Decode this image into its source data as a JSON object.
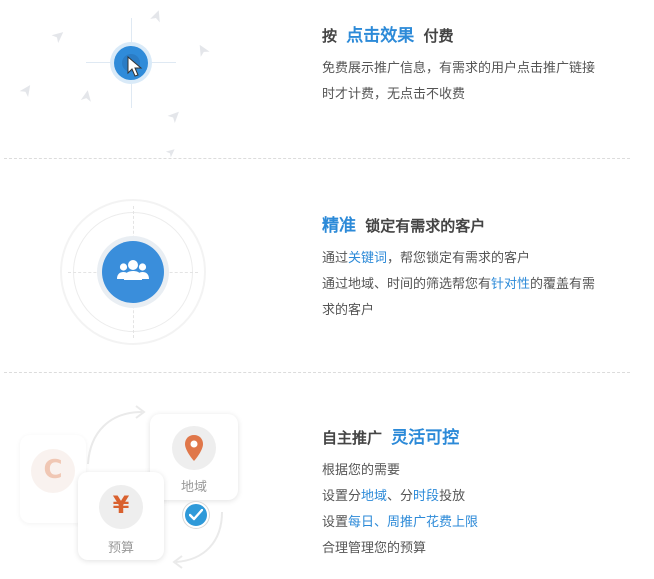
{
  "sections": [
    {
      "title_prefix": "按",
      "title_highlight": "点击效果",
      "title_suffix": "付费",
      "desc": [
        "免费展示推广信息，有需求的用户点击推广链接",
        "时才计费，无点击不收费"
      ]
    },
    {
      "title_highlight": "精准",
      "title_suffix": "锁定有需求的客户",
      "line1": {
        "pre": "通过",
        "kw": "关键词",
        "post": "，帮您锁定有需求的客户"
      },
      "line2": {
        "pre": "通过地域、时间的筛选帮您有",
        "kw": "针对性",
        "post": "的覆盖有需"
      },
      "line3": "求的客户"
    },
    {
      "title_prefix": "自主推广",
      "title_highlight": "灵活可控",
      "line1": "根据您的需要",
      "line2": {
        "pre": "设置分",
        "kw1": "地域",
        "mid": "、分",
        "kw2": "时段",
        "post": "投放"
      },
      "line3": {
        "pre": "设置",
        "kw": "每日、周推广花费上限"
      },
      "line4": "合理管理您的预算"
    }
  ],
  "illustration": {
    "region_label": "地域",
    "budget_label": "预算",
    "yen_symbol": "¥",
    "coin_symbol": "C"
  },
  "icons": {
    "cursor": "mouse-pointer-icon",
    "people": "users-group-icon",
    "location": "location-pin-icon",
    "check": "check-circle-icon",
    "arrows": "arrow-pointer-icon"
  },
  "colors": {
    "accent": "#2c8ad8",
    "text": "#444444",
    "pin": "#e0774a",
    "divider": "#dcdcdc"
  }
}
